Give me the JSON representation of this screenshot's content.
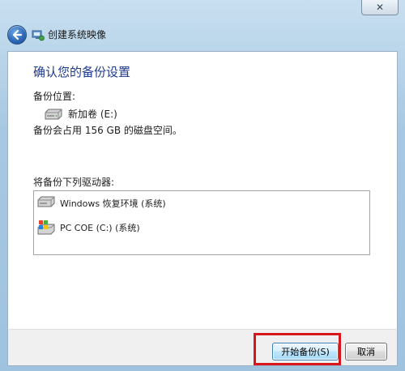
{
  "window": {
    "title": "创建系统映像",
    "close_glyph": "✕"
  },
  "page": {
    "heading": "确认您的备份设置",
    "location_label": "备份位置:",
    "target_drive": "新加卷 (E:)",
    "space_text": "备份会占用 156 GB 的磁盘空间。",
    "list_label": "将备份下列驱动器:",
    "drives": [
      {
        "label": "Windows 恢复环境 (系统)",
        "icon": "drive-icon"
      },
      {
        "label": "PC COE (C:) (系统)",
        "icon": "windows-drive-icon"
      }
    ]
  },
  "footer": {
    "start_label": "开始备份(S)",
    "cancel_label": "取消"
  },
  "colors": {
    "heading": "#1e3a8f",
    "highlight": "#d8161b",
    "frame": "#a7c8e2"
  }
}
